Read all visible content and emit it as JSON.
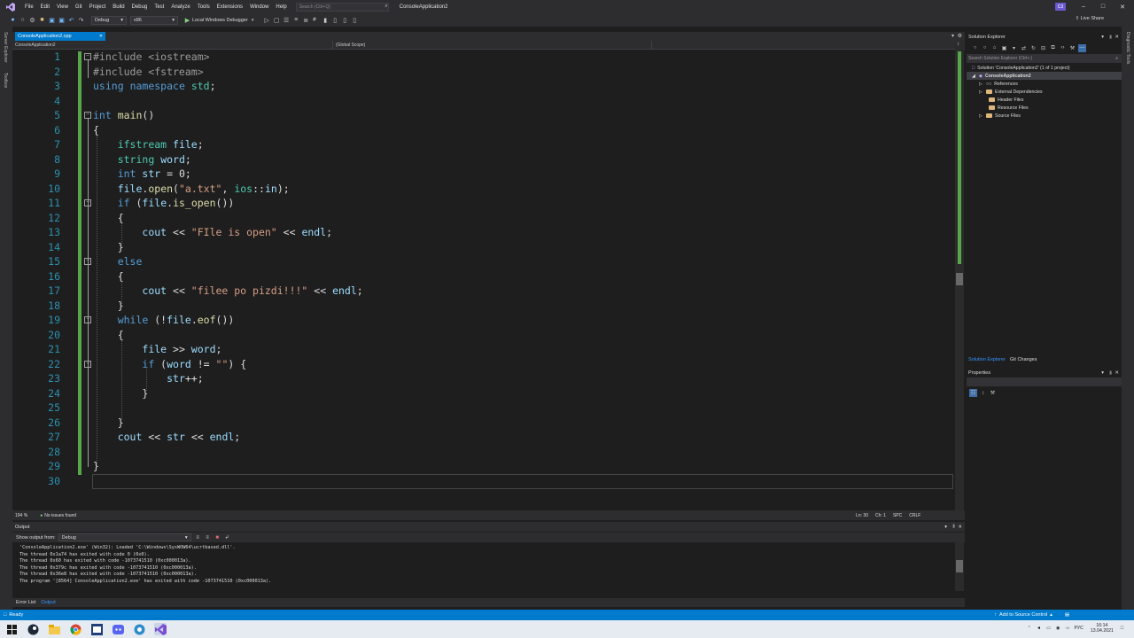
{
  "menubar": {
    "items": [
      "File",
      "Edit",
      "View",
      "Git",
      "Project",
      "Build",
      "Debug",
      "Test",
      "Analyze",
      "Tools",
      "Extensions",
      "Window",
      "Help"
    ],
    "search_placeholder": "Search (Ctrl+Q)",
    "app_name": "ConsoleApplication2",
    "user_initials": "C3"
  },
  "toolbar": {
    "config": "Debug",
    "platform": "x86",
    "run_label": "Local Windows Debugger",
    "live_share": "Live Share"
  },
  "side_tabs": {
    "left": [
      "Server Explorer",
      "Toolbox"
    ],
    "right": [
      "Diagnostic Tools"
    ]
  },
  "editor": {
    "tab_title": "ConsoleApplication2.cpp",
    "nav_project": "ConsoleApplication2",
    "nav_scope": "(Global Scope)",
    "zoom": "194 %",
    "issues": "No issues found",
    "position": {
      "ln": "Ln: 30",
      "ch": "Ch: 1",
      "spc": "SPC",
      "eol": "CRLF"
    },
    "lines": [
      "#include <iostream>",
      "#include <fstream>",
      "using namespace std;",
      "",
      "int main()",
      "{",
      "    ifstream file;",
      "    string word;",
      "    int str = 0;",
      "    file.open(\"a.txt\", ios::in);",
      "    if (file.is_open())",
      "    {",
      "        cout << \"FIle is open\" << endl;",
      "    }",
      "    else",
      "    {",
      "        cout << \"filee po pizdi!!!\" << endl;",
      "    }",
      "    while (!file.eof())",
      "    {",
      "        file >> word;",
      "        if (word != \"\") {",
      "            str++;",
      "        }",
      "",
      "    }",
      "    cout << str << endl;",
      "",
      "}",
      ""
    ]
  },
  "output": {
    "title": "Output",
    "show_from_label": "Show output from:",
    "source": "Debug",
    "lines": [
      "'ConsoleApplication2.exe' (Win32): Loaded 'C:\\Windows\\SysWOW64\\ucrtbased.dll'.",
      "The thread 0x1a74 has exited with code 0 (0x0).",
      "The thread 0x60 has exited with code -1073741510 (0xc000013a).",
      "The thread 0x379c has exited with code -1073741510 (0xc000013a).",
      "The thread 0x36e8 has exited with code -1073741510 (0xc000013a).",
      "The program '[8564] ConsoleApplication2.exe' has exited with code -1073741510 (0xc000013a)."
    ],
    "bottom_tabs": [
      "Error List",
      "Output"
    ]
  },
  "solution_explorer": {
    "title": "Solution Explorer",
    "search_placeholder": "Search Solution Explorer (Ctrl+;)",
    "solution_label": "Solution 'ConsoleApplication2' (1 of 1 project)",
    "project": "ConsoleApplication2",
    "items": [
      "References",
      "External Dependencies",
      "Header Files",
      "Resource Files",
      "Source Files"
    ],
    "tabs": [
      "Solution Explorer",
      "Git Changes"
    ]
  },
  "properties": {
    "title": "Properties"
  },
  "statusbar": {
    "state": "Ready",
    "source_control": "Add to Source Control"
  },
  "taskbar": {
    "lang": "РУС",
    "time": "16:14",
    "date": "13.04.2021"
  }
}
